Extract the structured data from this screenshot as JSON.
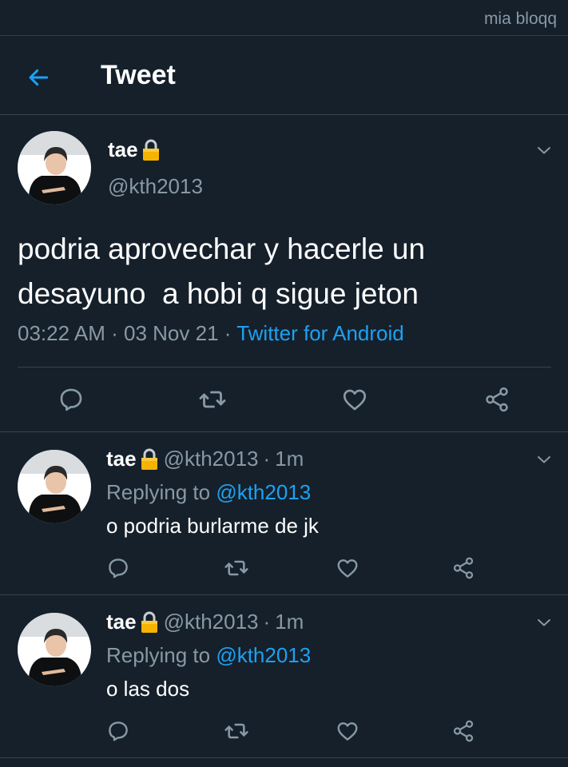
{
  "watermark": "mia bloqq",
  "header": {
    "title": "Tweet",
    "back_icon": "arrow-left-icon"
  },
  "colors": {
    "background": "#15202b",
    "accent": "#1da1f2",
    "secondary_text": "#8899a6",
    "divider": "#38444d"
  },
  "main_tweet": {
    "name": "tae",
    "handle": "@kth2013",
    "text": "podria aprovechar y hacerle un\ndesayuno  a hobi q sigue jeton",
    "time": "03:22 AM",
    "date": "03 Nov 21",
    "separator": "·",
    "source": "Twitter for Android"
  },
  "replies": [
    {
      "name": "tae",
      "handle": "@kth2013",
      "time": "1m",
      "separator": "·",
      "replying_label": "Replying to",
      "replying_to": "@kth2013",
      "text": "o podria burlarme de jk"
    },
    {
      "name": "tae",
      "handle": "@kth2013",
      "time": "1m",
      "separator": "·",
      "replying_label": "Replying to",
      "replying_to": "@kth2013",
      "text": "o las dos"
    }
  ],
  "action_icons": [
    "reply-icon",
    "retweet-icon",
    "like-icon",
    "share-icon"
  ]
}
